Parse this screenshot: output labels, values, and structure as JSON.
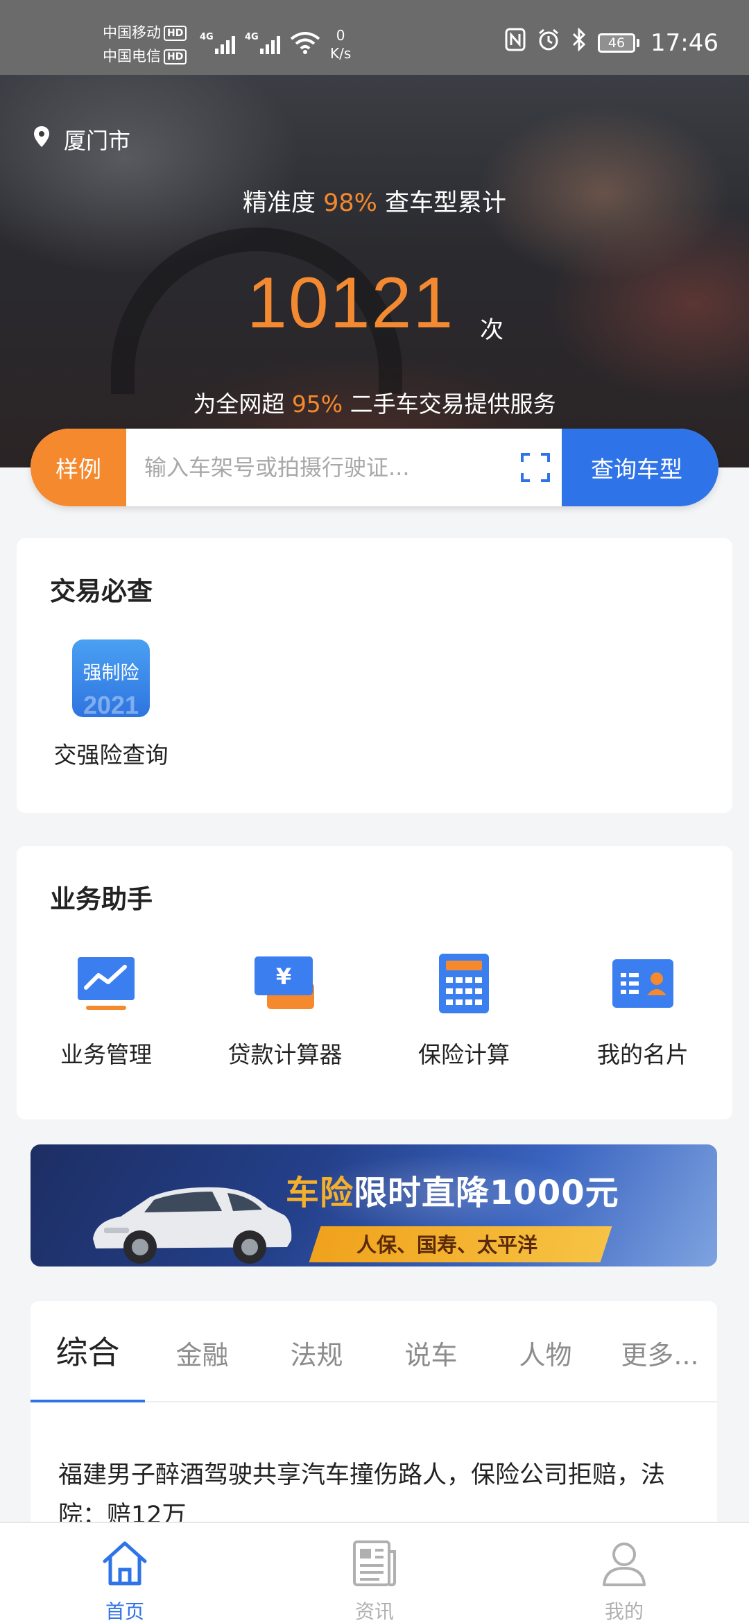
{
  "status_bar": {
    "carrier1": "中国移动",
    "carrier2": "中国电信",
    "hd_badge": "HD",
    "network": "4G",
    "speed_value": "0",
    "speed_unit": "K/s",
    "battery": "46",
    "time": "17:46",
    "icons": [
      "nfc-icon",
      "alarm-icon",
      "bluetooth-icon"
    ]
  },
  "hero": {
    "city": "厦门市",
    "accuracy_prefix": "精准度",
    "accuracy_value": "98%",
    "accuracy_suffix": "查车型累计",
    "count": "10121",
    "count_unit": "次",
    "service_prefix": "为全网超",
    "service_value": "95%",
    "service_suffix": "二手车交易提供服务"
  },
  "search": {
    "sample_label": "样例",
    "placeholder": "输入车架号或拍摄行驶证...",
    "submit_label": "查询车型"
  },
  "must_check": {
    "title": "交易必查",
    "items": [
      {
        "tile_text": "强制险",
        "tile_year": "2021",
        "label": "交强险查询"
      }
    ]
  },
  "assistant": {
    "title": "业务助手",
    "items": [
      {
        "label": "业务管理",
        "icon": "trend-chart-icon"
      },
      {
        "label": "贷款计算器",
        "icon": "yuan-card-icon"
      },
      {
        "label": "保险计算",
        "icon": "calculator-icon"
      },
      {
        "label": "我的名片",
        "icon": "business-card-icon"
      }
    ]
  },
  "banner": {
    "headline_highlight": "车险",
    "headline_rest": "限时直降1000元",
    "subline": "人保、国寿、太平洋"
  },
  "news": {
    "tabs": [
      "综合",
      "金融",
      "法规",
      "说车",
      "人物",
      "更多..."
    ],
    "active_tab": "综合",
    "headline": "福建男子醉酒驾驶共享汽车撞伤路人，保险公司拒赔，法院：赔12万"
  },
  "tabbar": {
    "items": [
      {
        "label": "首页",
        "icon": "home-icon",
        "active": true
      },
      {
        "label": "资讯",
        "icon": "news-icon",
        "active": false
      },
      {
        "label": "我的",
        "icon": "profile-icon",
        "active": false
      }
    ]
  },
  "colors": {
    "accent_orange": "#f5892e",
    "primary_blue": "#2f73e8",
    "tab_inactive": "#b0b0b0"
  }
}
